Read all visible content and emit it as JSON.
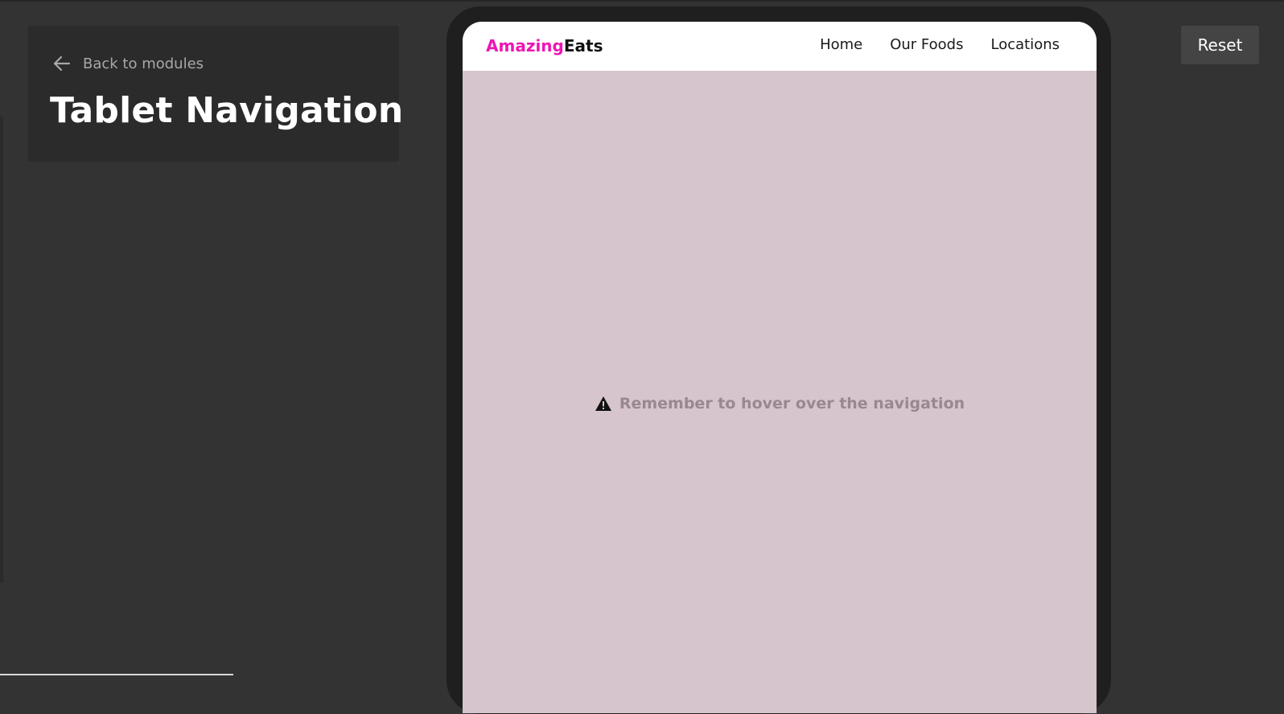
{
  "header": {
    "back_label": "Back to modules",
    "title": "Tablet Navigation"
  },
  "toolbar": {
    "reset_label": "Reset"
  },
  "preview": {
    "logo": {
      "part1": "Amazing",
      "part2": "Eats"
    },
    "nav": [
      {
        "label": "Home"
      },
      {
        "label": "Our Foods"
      },
      {
        "label": "Locations"
      }
    ],
    "notice": {
      "icon": "warning-icon",
      "text": "Remember to hover over the navigation"
    }
  },
  "icons": {
    "back": "arrow-left-icon",
    "notice": "warning-icon"
  },
  "colors": {
    "page_background": "#333333",
    "card_background": "#2b2b2b",
    "device_frame": "#1f1f1f",
    "screen_background": "#d6c5cc",
    "brand_pink": "#ee15b4",
    "notice_text": "#9a8890",
    "reset_button": "#444444"
  }
}
